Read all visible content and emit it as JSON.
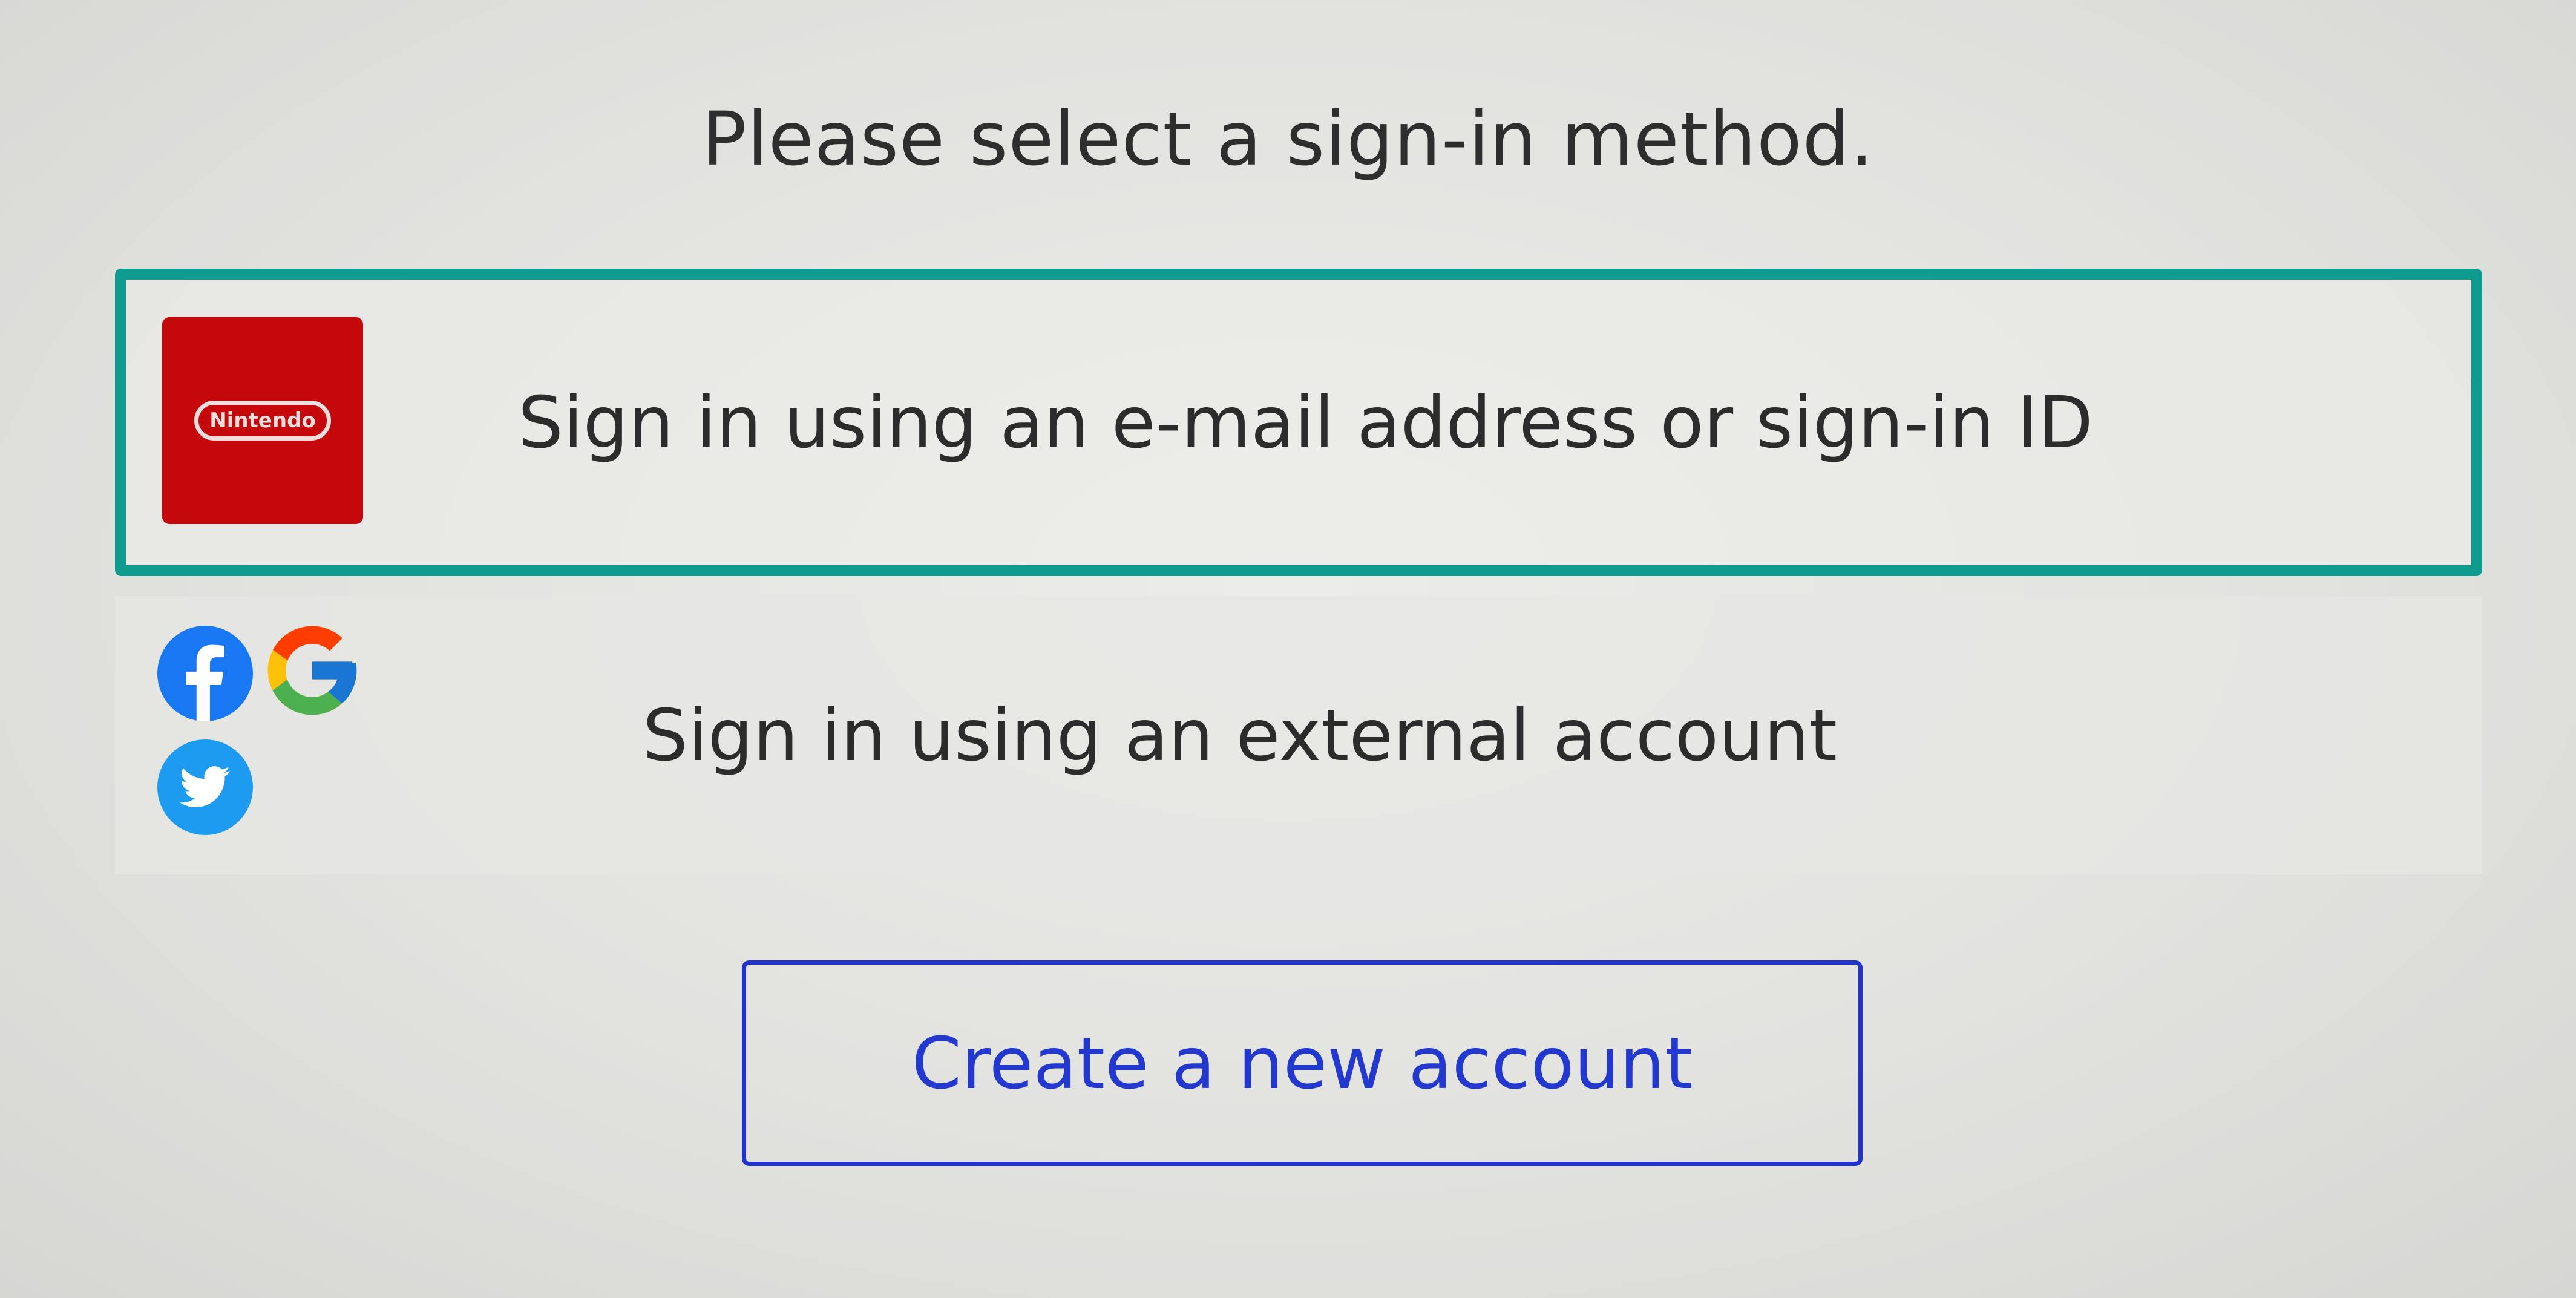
{
  "header": {
    "title": "Please select a sign-in method."
  },
  "options": [
    {
      "label": "Sign in using an e-mail address or sign-in ID",
      "icon": "nintendo-logo",
      "logo_text": "Nintendo",
      "selected": true
    },
    {
      "label": "Sign in using an external account",
      "icons": [
        "facebook-icon",
        "google-icon",
        "twitter-icon"
      ],
      "selected": false
    }
  ],
  "actions": {
    "create_account_label": "Create a new account"
  },
  "colors": {
    "selection_border": "#0f9b8e",
    "nintendo_red": "#c4080b",
    "facebook_blue": "#1877f2",
    "twitter_blue": "#1d9bf0",
    "button_blue": "#2233cc"
  }
}
